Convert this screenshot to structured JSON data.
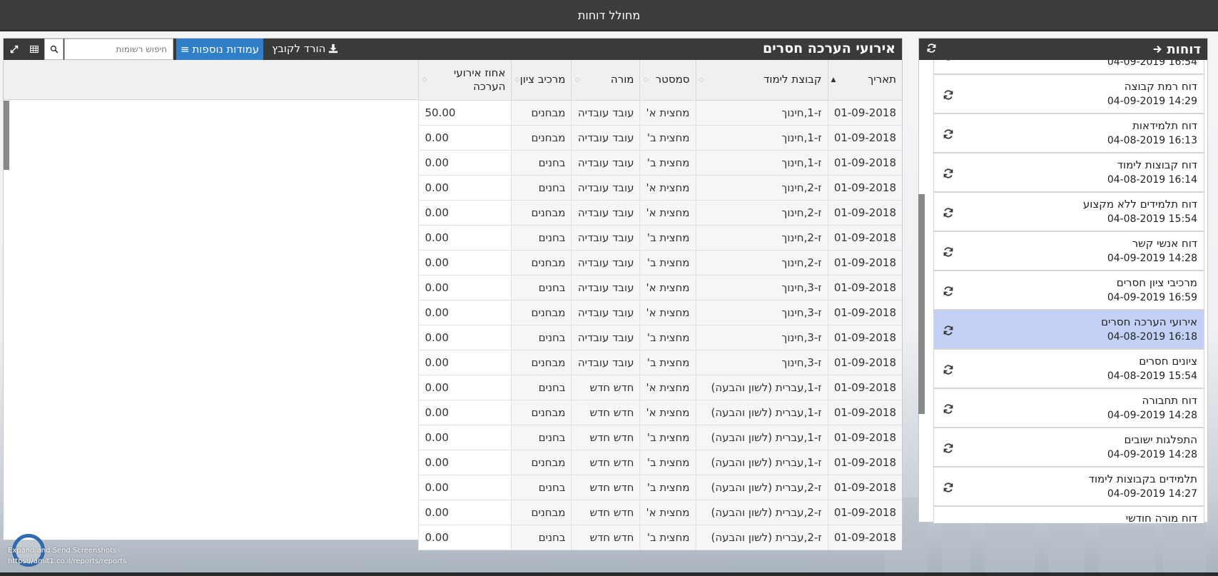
{
  "app": {
    "title": "מחולל דוחות"
  },
  "sidebar": {
    "title": "דוחות",
    "items": [
      {
        "name": "",
        "date": "16:54 04-09-2019",
        "active": false
      },
      {
        "name": "דוח רמת קבוצה",
        "date": "14:29 04-09-2019",
        "active": false
      },
      {
        "name": "דוח תלמידאות",
        "date": "16:13 04-08-2019",
        "active": false
      },
      {
        "name": "דוח קבוצות לימוד",
        "date": "16:14 04-08-2019",
        "active": false
      },
      {
        "name": "דוח תלמידים ללא מקצוע",
        "date": "15:54 04-08-2019",
        "active": false
      },
      {
        "name": "דוח אנשי קשר",
        "date": "14:28 04-09-2019",
        "active": false
      },
      {
        "name": "מרכיבי ציון חסרים",
        "date": "16:59 04-09-2019",
        "active": false
      },
      {
        "name": "אירועי הערכה חסרים",
        "date": "16:18 04-08-2019",
        "active": true
      },
      {
        "name": "ציונים חסרים",
        "date": "15:54 04-08-2019",
        "active": false
      },
      {
        "name": "דוח תחבורה",
        "date": "14:28 04-09-2019",
        "active": false
      },
      {
        "name": "התפלגות ישובים",
        "date": "14:28 04-09-2019",
        "active": false
      },
      {
        "name": "תלמידים בקבוצות לימוד",
        "date": "14:27 04-09-2019",
        "active": false
      },
      {
        "name": "דוח מורה חודשי",
        "date": "",
        "active": false
      }
    ]
  },
  "report": {
    "title": "אירועי הערכה חסרים",
    "download_label": "הורד לקובץ",
    "columns_label": "עמודות נוספות",
    "search_placeholder": "חיפוש רשומות",
    "columns": [
      "תאריך",
      "קבוצת לימוד",
      "סמסטר",
      "מורה",
      "מרכיב ציון",
      "אחוז אירועי הערכה"
    ],
    "rows": [
      [
        "01-09-2018",
        "ז-1,חינוך",
        "מחצית א'",
        "עובד עובדיה",
        "מבחנים",
        "50.00"
      ],
      [
        "01-09-2018",
        "ז-1,חינוך",
        "מחצית ב'",
        "עובד עובדיה",
        "מבחנים",
        "0.00"
      ],
      [
        "01-09-2018",
        "ז-1,חינוך",
        "מחצית ב'",
        "עובד עובדיה",
        "בחנים",
        "0.00"
      ],
      [
        "01-09-2018",
        "ז-2,חינוך",
        "מחצית א'",
        "עובד עובדיה",
        "בחנים",
        "0.00"
      ],
      [
        "01-09-2018",
        "ז-2,חינוך",
        "מחצית א'",
        "עובד עובדיה",
        "מבחנים",
        "0.00"
      ],
      [
        "01-09-2018",
        "ז-2,חינוך",
        "מחצית ב'",
        "עובד עובדיה",
        "בחנים",
        "0.00"
      ],
      [
        "01-09-2018",
        "ז-2,חינוך",
        "מחצית ב'",
        "עובד עובדיה",
        "מבחנים",
        "0.00"
      ],
      [
        "01-09-2018",
        "ז-3,חינוך",
        "מחצית א'",
        "עובד עובדיה",
        "בחנים",
        "0.00"
      ],
      [
        "01-09-2018",
        "ז-3,חינוך",
        "מחצית א'",
        "עובד עובדיה",
        "מבחנים",
        "0.00"
      ],
      [
        "01-09-2018",
        "ז-3,חינוך",
        "מחצית ב'",
        "עובד עובדיה",
        "בחנים",
        "0.00"
      ],
      [
        "01-09-2018",
        "ז-3,חינוך",
        "מחצית ב'",
        "עובד עובדיה",
        "מבחנים",
        "0.00"
      ],
      [
        "01-09-2018",
        "ז-1,עברית (לשון והבעה)",
        "מחצית א'",
        "חדש חדש",
        "בחנים",
        "0.00"
      ],
      [
        "01-09-2018",
        "ז-1,עברית (לשון והבעה)",
        "מחצית א'",
        "חדש חדש",
        "מבחנים",
        "0.00"
      ],
      [
        "01-09-2018",
        "ז-1,עברית (לשון והבעה)",
        "מחצית ב'",
        "חדש חדש",
        "בחנים",
        "0.00"
      ],
      [
        "01-09-2018",
        "ז-1,עברית (לשון והבעה)",
        "מחצית ב'",
        "חדש חדש",
        "מבחנים",
        "0.00"
      ],
      [
        "01-09-2018",
        "ז-2,עברית (לשון והבעה)",
        "מחצית ב'",
        "חדש חדש",
        "בחנים",
        "0.00"
      ],
      [
        "01-09-2018",
        "ז-2,עברית (לשון והבעה)",
        "מחצית א'",
        "חדש חדש",
        "מבחנים",
        "0.00"
      ],
      [
        "01-09-2018",
        "ז-2,עברית (לשון והבעה)",
        "מחצית ב'",
        "חדש חדש",
        "בחנים",
        "0.00"
      ]
    ]
  },
  "overlay": {
    "line1": "Expand and Send Screenshots",
    "line2": "https://amit1.co.il/reports/reports"
  }
}
